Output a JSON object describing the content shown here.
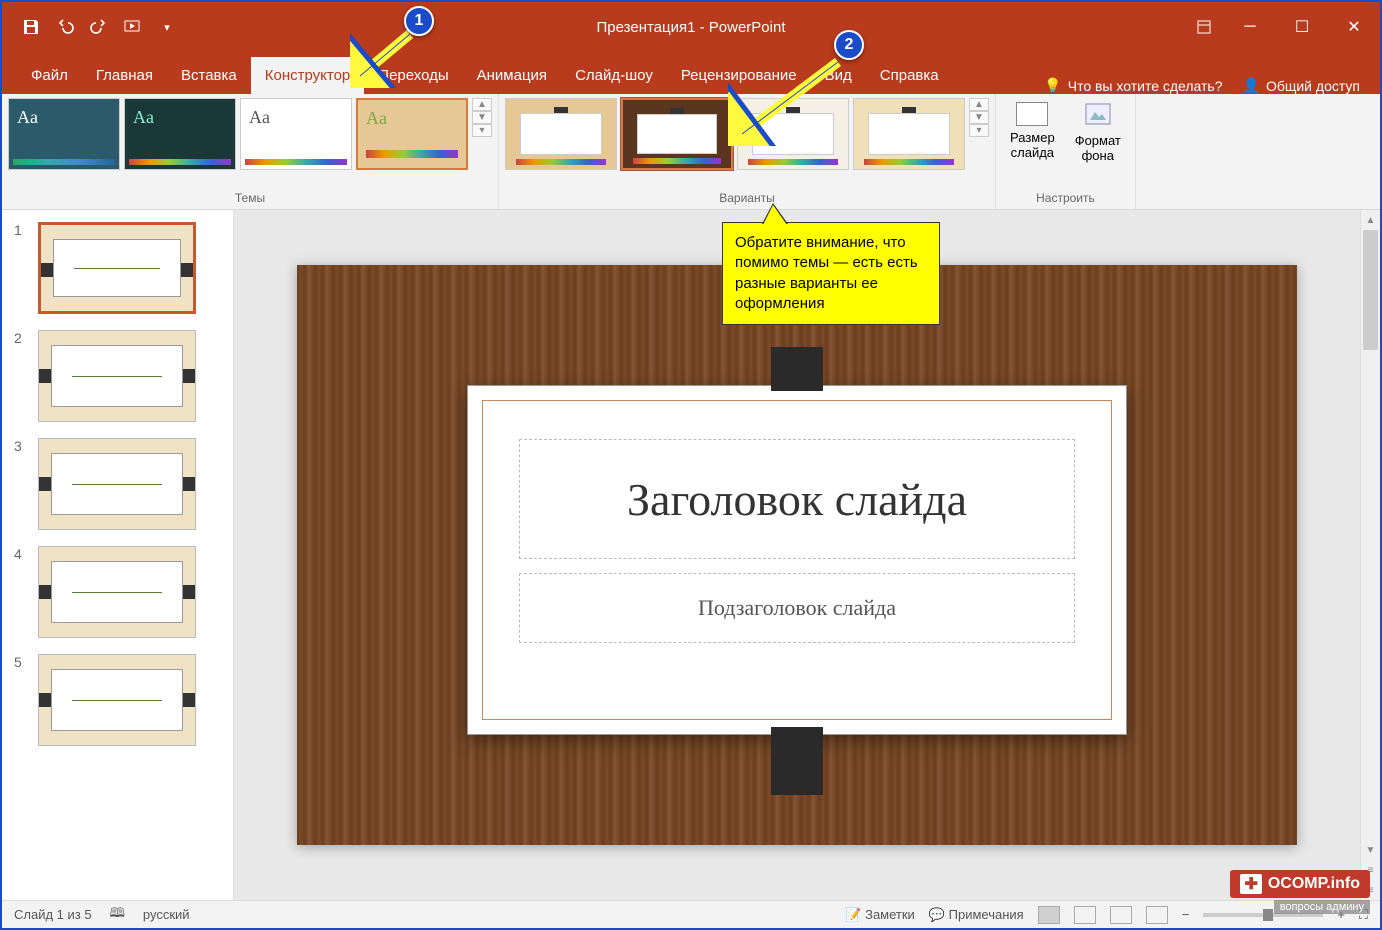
{
  "title": "Презентация1 - PowerPoint",
  "tabs": {
    "file": "Файл",
    "home": "Главная",
    "insert": "Вставка",
    "design": "Конструктор",
    "transitions": "Переходы",
    "animations": "Анимация",
    "slideshow": "Слайд-шоу",
    "review": "Рецензирование",
    "view": "Вид",
    "help": "Справка"
  },
  "tellme": "Что вы хотите сделать?",
  "share": "Общий доступ",
  "ribbon": {
    "themes_label": "Темы",
    "variants_label": "Варианты",
    "config_label": "Настроить",
    "slide_size": "Размер\nслайда",
    "format_bg": "Формат\nфона"
  },
  "slides": {
    "count": 5,
    "selected": 1
  },
  "slide_content": {
    "title": "Заголовок слайда",
    "subtitle": "Подзаголовок слайда"
  },
  "status": {
    "counter": "Слайд 1 из 5",
    "lang": "русский",
    "notes": "Заметки",
    "comments": "Примечания"
  },
  "annotations": {
    "marker1": "1",
    "marker2": "2",
    "callout": "Обратите внимание, что помимо темы — есть есть разные варианты ее оформления"
  },
  "watermark": {
    "brand": "OCOMP.info",
    "sub": "вопросы админу"
  }
}
